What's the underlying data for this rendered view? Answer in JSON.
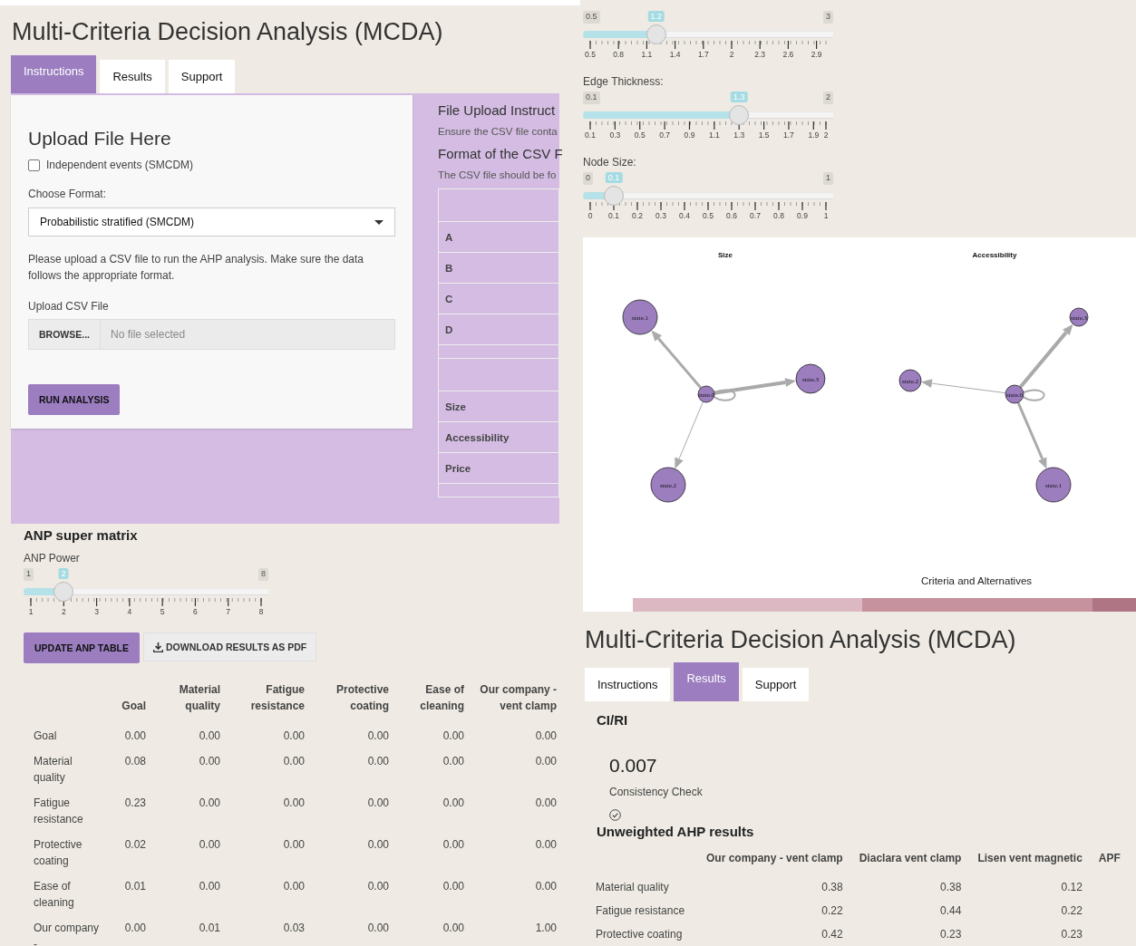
{
  "instructions_view": {
    "title": "Multi-Criteria Decision Analysis (MCDA)",
    "tabs": [
      {
        "label": "Instructions",
        "selected": true
      },
      {
        "label": "Results",
        "selected": false
      },
      {
        "label": "Support",
        "selected": false
      }
    ],
    "upload_card": {
      "heading": "Upload File Here",
      "checkbox": {
        "label": "Independent events (SMCDM)",
        "checked": false
      },
      "format_label": "Choose Format:",
      "format_value": "Probabilistic stratified (SMCDM)",
      "note": "Please upload a CSV file to run the AHP analysis. Make sure the data follows the appropriate format.",
      "upload_label": "Upload CSV File",
      "browse_button": "BROWSE...",
      "file_placeholder": "No file selected",
      "run_button": "RUN ANALYSIS"
    },
    "file_instructions": {
      "heading": "File Upload Instruct",
      "text": "Ensure the CSV file conta",
      "format_heading": "Format of the CSV F",
      "format_text": "The CSV file should be fo",
      "table_groups": [
        [
          "A",
          "B",
          "C",
          "D"
        ],
        [
          "Size",
          "Accessibility",
          "Price"
        ]
      ]
    }
  },
  "sliders": [
    {
      "min": "0.5",
      "max": "3",
      "value": "1.2",
      "level": 0.28,
      "ticks": [
        "0.5",
        "0.8",
        "1.1",
        "1.4",
        "1.7",
        "2",
        "2.3",
        "2.6",
        "2.9"
      ]
    },
    {
      "label": "Edge Thickness:",
      "min": "0.1",
      "max": "2",
      "value": "1.3",
      "level": 0.632,
      "ticks": [
        "0.1",
        "0.3",
        "0.5",
        "0.7",
        "0.9",
        "1.1",
        "1.3",
        "1.5",
        "1.7",
        "1.9",
        "2"
      ]
    },
    {
      "label": "Node Size:",
      "min": "0",
      "max": "1",
      "value": "0.1",
      "level": 0.1,
      "ticks": [
        "0",
        "0.1",
        "0.2",
        "0.3",
        "0.4",
        "0.5",
        "0.6",
        "0.7",
        "0.8",
        "0.9",
        "1"
      ]
    }
  ],
  "network": {
    "graphs": [
      {
        "title": "Size",
        "nodes": [
          "state.0",
          "state.1",
          "state.2",
          "state.3"
        ]
      },
      {
        "title": "Accessibility",
        "nodes": [
          "state.0",
          "state.1",
          "state.2",
          "state.3"
        ]
      }
    ],
    "caption": "Criteria and Alternatives"
  },
  "anp": {
    "heading": "ANP super matrix",
    "power_slider": {
      "label": "ANP Power",
      "min": "1",
      "max": "8",
      "value": "2",
      "level": 0.143,
      "ticks": [
        "1",
        "2",
        "3",
        "4",
        "5",
        "6",
        "7",
        "8"
      ]
    },
    "update_button": "UPDATE ANP TABLE",
    "download_button": "DOWNLOAD RESULTS AS PDF",
    "table": {
      "columns": [
        "Goal",
        "Material quality",
        "Fatigue resistance",
        "Protective coating",
        "Ease of cleaning",
        "Our company - vent clamp"
      ],
      "rows": [
        {
          "label": "Goal",
          "cells": [
            "0.00",
            "0.00",
            "0.00",
            "0.00",
            "0.00",
            "0.00"
          ]
        },
        {
          "label": "Material quality",
          "cells": [
            "0.08",
            "0.00",
            "0.00",
            "0.00",
            "0.00",
            "0.00"
          ]
        },
        {
          "label": "Fatigue resistance",
          "cells": [
            "0.23",
            "0.00",
            "0.00",
            "0.00",
            "0.00",
            "0.00"
          ]
        },
        {
          "label": "Protective coating",
          "cells": [
            "0.02",
            "0.00",
            "0.00",
            "0.00",
            "0.00",
            "0.00"
          ]
        },
        {
          "label": "Ease of cleaning",
          "cells": [
            "0.01",
            "0.00",
            "0.00",
            "0.00",
            "0.00",
            "0.00"
          ]
        },
        {
          "label": "Our company -",
          "cells": [
            "0.00",
            "0.01",
            "0.03",
            "0.00",
            "0.00",
            "1.00"
          ]
        }
      ]
    }
  },
  "results_view": {
    "title": "Multi-Criteria Decision Analysis (MCDA)",
    "tabs": [
      {
        "label": "Instructions",
        "selected": false
      },
      {
        "label": "Results",
        "selected": true
      },
      {
        "label": "Support",
        "selected": false
      }
    ],
    "ci_heading": "CI/RI",
    "ci_value": "0.007",
    "ci_caption": "Consistency Check",
    "ahp_heading": "Unweighted AHP results",
    "table": {
      "columns": [
        "Our company - vent clamp",
        "Diaclara vent clamp",
        "Lisen vent magnetic",
        "APF"
      ],
      "rows": [
        {
          "label": "Material quality",
          "cells": [
            "0.38",
            "0.38",
            "0.12"
          ]
        },
        {
          "label": "Fatigue resistance",
          "cells": [
            "0.22",
            "0.44",
            "0.22"
          ]
        },
        {
          "label": "Protective coating",
          "cells": [
            "0.42",
            "0.23",
            "0.23"
          ]
        }
      ]
    }
  }
}
